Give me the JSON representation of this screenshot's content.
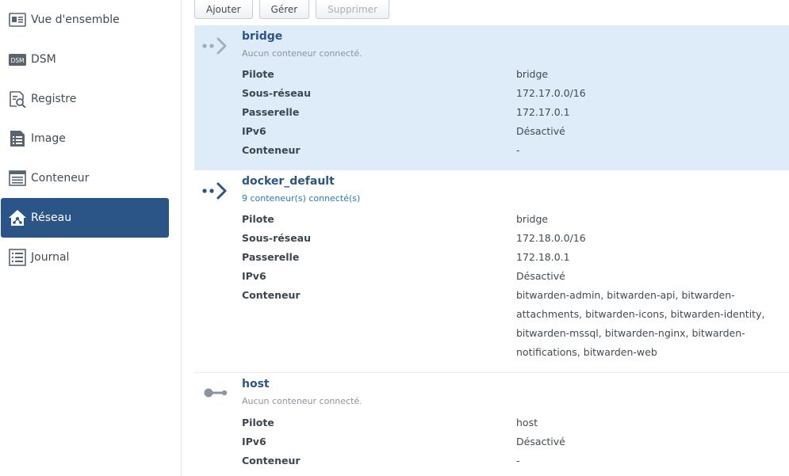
{
  "sidebar": {
    "items": [
      {
        "label": "Vue d'ensemble",
        "icon": "overview-icon"
      },
      {
        "label": "DSM",
        "icon": "dsm-icon"
      },
      {
        "label": "Registre",
        "icon": "registry-icon"
      },
      {
        "label": "Image",
        "icon": "image-icon"
      },
      {
        "label": "Conteneur",
        "icon": "container-icon"
      },
      {
        "label": "Réseau",
        "icon": "network-icon",
        "active": true
      },
      {
        "label": "Journal",
        "icon": "log-icon"
      }
    ],
    "dsm_badge": "DSM"
  },
  "toolbar": {
    "add_label": "Ajouter",
    "manage_label": "Gérer",
    "delete_label": "Supprimer"
  },
  "networks": [
    {
      "name": "bridge",
      "status": "Aucun conteneur connecté.",
      "rows": [
        {
          "label": "Pilote",
          "value": "bridge"
        },
        {
          "label": "Sous-réseau",
          "value": "172.17.0.0/16"
        },
        {
          "label": "Passerelle",
          "value": "172.17.0.1"
        },
        {
          "label": "IPv6",
          "value": "Désactivé"
        },
        {
          "label": "Conteneur",
          "value": "-"
        }
      ]
    },
    {
      "name": "docker_default",
      "status": "9 conteneur(s) connecté(s)",
      "rows": [
        {
          "label": "Pilote",
          "value": "bridge"
        },
        {
          "label": "Sous-réseau",
          "value": "172.18.0.0/16"
        },
        {
          "label": "Passerelle",
          "value": "172.18.0.1"
        },
        {
          "label": "IPv6",
          "value": "Désactivé"
        },
        {
          "label": "Conteneur",
          "value_lines": [
            "bitwarden-admin, bitwarden-api, bitwarden-",
            "attachments, bitwarden-icons, bitwarden-identity,",
            "bitwarden-mssql, bitwarden-nginx, bitwarden-",
            "notifications, bitwarden-web"
          ]
        }
      ]
    },
    {
      "name": "host",
      "status": "Aucun conteneur connecté.",
      "rows": [
        {
          "label": "Pilote",
          "value": "host"
        },
        {
          "label": "IPv6",
          "value": "Désactivé"
        },
        {
          "label": "Conteneur",
          "value": "-"
        }
      ]
    }
  ],
  "colors": {
    "accent": "#2b5586",
    "selected_row": "#deebf8",
    "link": "#2a78c4"
  }
}
